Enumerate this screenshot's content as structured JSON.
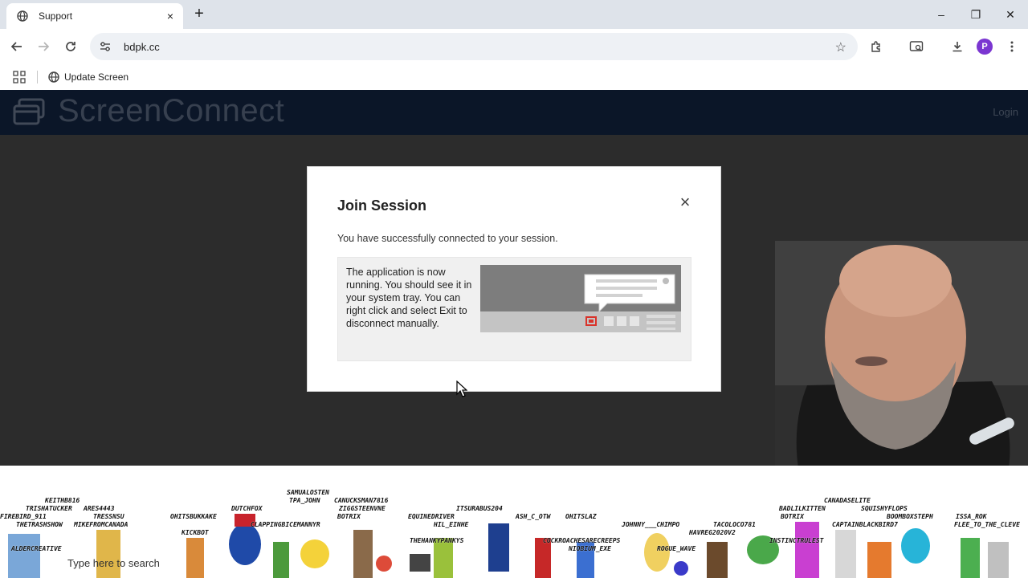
{
  "browser": {
    "tab": {
      "title": "Support",
      "close_glyph": "×"
    },
    "new_tab_glyph": "+",
    "window_controls": {
      "minimize": "–",
      "maximize": "❐",
      "close": "✕"
    },
    "url": "bdpk.cc",
    "profile_initial": "P",
    "bookmarks": {
      "item_label": "Update Screen"
    }
  },
  "page": {
    "logo_text": "ScreenConnect",
    "login_label": "Login"
  },
  "modal": {
    "title": "Join Session",
    "close_glyph": "×",
    "message": "You have successfully connected to your session.",
    "info_text": "The application is now running. You should see it in your system tray. You can right click and select Exit to disconnect manually."
  },
  "stream_overlay": {
    "taskbar_search_text": "Type here to search",
    "viewer_names": [
      "KEITHB816",
      "TRISHATUCKER",
      "ARES4443",
      "FIREBIRD_911",
      "TRESSNSU",
      "THETRASHSHOW",
      "MIKEFROMCANADA",
      "OHITSBUKKAKE",
      "DUTCHFOX",
      "KICKBOT",
      "SAMUALOSTEN",
      "TPA_JOHN",
      "CANUCKSMAN7816",
      "ZIGGSTEENVNE",
      "BOTRIX",
      "CLAPPINGBICEMANNYR",
      "EQUINEDRIVER",
      "HIL_EINHE",
      "ITSURABUS204",
      "ASH_C_OTW",
      "OHITSLAZ",
      "THEHANKYPANKYS",
      "COCKROACHESARECREEPS",
      "NIOBIUM_EXE",
      "JOHNNY___CHIMPO",
      "ROGUE_WAVE",
      "HAVREG2020V2",
      "TACOLOCO781",
      "BADLILKITTEN",
      "BOTRIX",
      "CANADASELITE",
      "SQUISHYFLOPS",
      "CAPTAINBLACKBIRD7",
      "INSTINCTRULEST",
      "BOOMBOXSTEPH",
      "ISSA_ROK",
      "FLEE_TO_THE_CLEVE",
      "ALDERCREATIVE"
    ]
  },
  "colors": {
    "tabstrip": "#dee3ea",
    "header": "#0b1628",
    "page_bg": "#2c2c2c",
    "profile": "#7b36d1"
  }
}
